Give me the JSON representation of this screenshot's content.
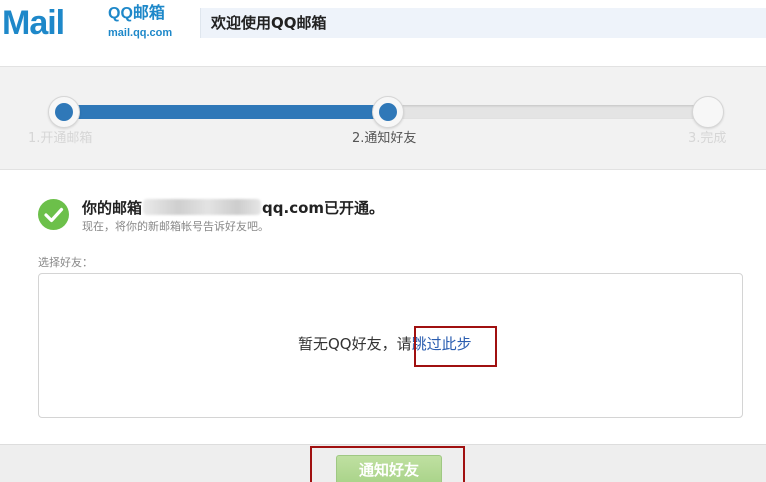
{
  "header": {
    "logo_text": "Mail",
    "logo_brand": "QQ邮箱",
    "logo_domain": "mail.qq.com",
    "welcome": "欢迎使用QQ邮箱"
  },
  "progress": {
    "steps": [
      {
        "label": "1.开通邮箱",
        "state": "done"
      },
      {
        "label": "2.通知好友",
        "state": "current"
      },
      {
        "label": "3.完成",
        "state": "todo"
      }
    ],
    "fill_fraction": 0.5,
    "accent_color": "#2f78b8"
  },
  "content": {
    "mailbox_prefix": "你的邮箱",
    "mailbox_suffix": "qq.com已开通。",
    "mailbox_sub": "现在，将你的新邮箱帐号告诉好友吧。",
    "select_label": "选择好友：",
    "empty_text": "暂无QQ好友，请",
    "skip_link": "跳过此步",
    "success_icon": "check-circle-icon",
    "success_color": "#6cc04a"
  },
  "footer": {
    "notify_button": "通知好友",
    "button_color": "#a9d389",
    "highlight_color": "#a01010"
  }
}
